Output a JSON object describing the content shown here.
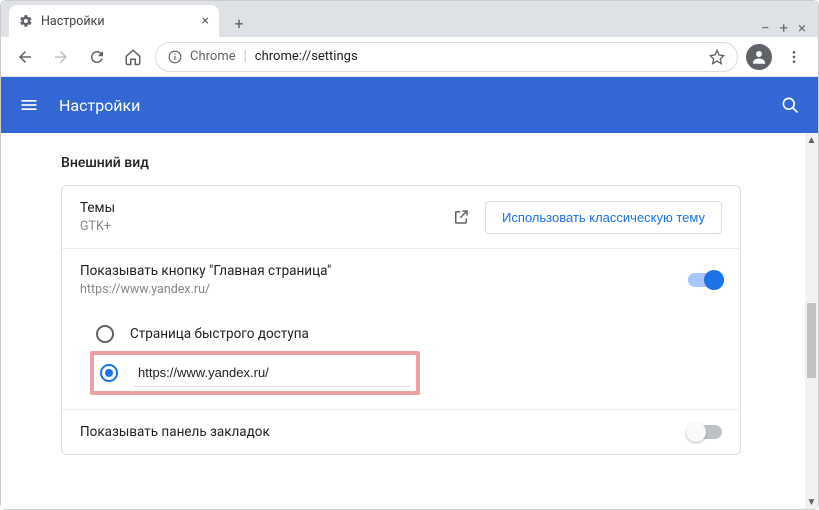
{
  "window": {
    "tab_title": "Настройки"
  },
  "toolbar": {
    "chrome_label": "Chrome",
    "url": "chrome://settings"
  },
  "header": {
    "title": "Настройки"
  },
  "appearance": {
    "section_title": "Внешний вид",
    "themes": {
      "title": "Темы",
      "sub": "GTK+",
      "button": "Использовать классическую тему"
    },
    "home_button": {
      "title": "Показывать кнопку \"Главная страница\"",
      "sub": "https://www.yandex.ru/",
      "radio_ntp": "Страница быстрого доступа",
      "radio_url_value": "https://www.yandex.ru/"
    },
    "bookmarks_bar": {
      "title": "Показывать панель закладок"
    }
  }
}
